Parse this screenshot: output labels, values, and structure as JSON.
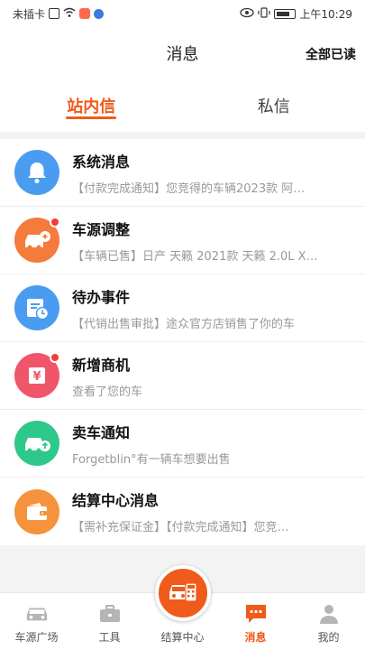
{
  "status_bar": {
    "carrier": "未插卡",
    "time": "上午10:29"
  },
  "header": {
    "title": "消息",
    "read_all": "全部已读"
  },
  "tabs": [
    {
      "label": "站内信",
      "active": true
    },
    {
      "label": "私信",
      "active": false
    }
  ],
  "messages": [
    {
      "title": "系统消息",
      "preview": "【付款完成通知】您竞得的车辆2023款 阿…",
      "icon": "bell-icon",
      "color": "#4a9cf0",
      "unread": false
    },
    {
      "title": "车源调整",
      "preview": "【车辆已售】日产 天籁 2021款 天籁 2.0L X…",
      "icon": "car-adjust-icon",
      "color": "#f47b3c",
      "unread": true
    },
    {
      "title": "待办事件",
      "preview": "【代销出售审批】途众官方店销售了你的车",
      "icon": "calendar-clock-icon",
      "color": "#4a9cf0",
      "unread": false
    },
    {
      "title": "新增商机",
      "preview": "查看了您的车",
      "icon": "yuan-tag-icon",
      "color": "#f0566a",
      "unread": true
    },
    {
      "title": "卖车通知",
      "preview": "Forgetblin°有一辆车想要出售",
      "icon": "car-upload-icon",
      "color": "#2ec88a",
      "unread": false
    },
    {
      "title": "结算中心消息",
      "preview": "【需补充保证金】【付款完成通知】您竞…",
      "icon": "wallet-icon",
      "color": "#f5923c",
      "unread": false
    }
  ],
  "tabbar": [
    {
      "label": "车源广场",
      "icon": "car-icon",
      "active": false
    },
    {
      "label": "工具",
      "icon": "toolbox-icon",
      "active": false
    },
    {
      "label": "结算中心",
      "icon": "calculator-car-icon",
      "active": false
    },
    {
      "label": "消息",
      "icon": "chat-bubble-icon",
      "active": true
    },
    {
      "label": "我的",
      "icon": "person-icon",
      "active": false
    }
  ],
  "colors": {
    "accent": "#f05a1a",
    "unread_dot": "#f43b3b"
  }
}
